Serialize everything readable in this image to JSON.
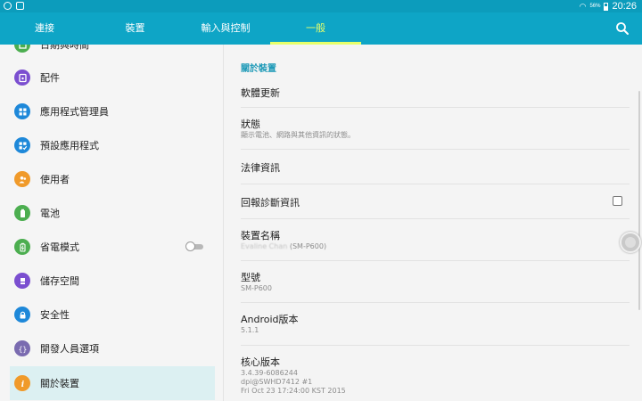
{
  "status_bar": {
    "battery_percent": "56%",
    "time": "20:26",
    "battery_level": 0.56,
    "icons": [
      "android-status-icon",
      "notification-icon",
      "wifi-icon",
      "battery-icon"
    ]
  },
  "tabs": [
    {
      "label": "連接",
      "active": false
    },
    {
      "label": "裝置",
      "active": false
    },
    {
      "label": "輸入與控制",
      "active": false
    },
    {
      "label": "一般",
      "active": true
    }
  ],
  "search_icon": "search-icon",
  "colors": {
    "tabbar": "#0ea5c6",
    "statusbar": "#0c9cbc",
    "active_tab": "#e7ff6a",
    "accent_text": "#1a98b6",
    "selected_item_bg": "#dcf0f2"
  },
  "left_menu": [
    {
      "label": "日期與時間",
      "icon": "calendar-icon",
      "color": "#4cae50",
      "active": false
    },
    {
      "label": "配件",
      "icon": "accessory-icon",
      "color": "#7b4fd0",
      "active": false
    },
    {
      "label": "應用程式管理員",
      "icon": "apps-grid-icon",
      "color": "#1e88d9",
      "active": false
    },
    {
      "label": "預設應用程式",
      "icon": "default-apps-icon",
      "color": "#1e88d9",
      "active": false
    },
    {
      "label": "使用者",
      "icon": "users-icon",
      "color": "#f09a2a",
      "active": false
    },
    {
      "label": "電池",
      "icon": "battery-icon",
      "color": "#4cae50",
      "active": false
    },
    {
      "label": "省電模式",
      "icon": "power-saving-icon",
      "color": "#4cae50",
      "active": false,
      "toggle": true
    },
    {
      "label": "儲存空間",
      "icon": "storage-icon",
      "color": "#7b4fd0",
      "active": false
    },
    {
      "label": "安全性",
      "icon": "lock-icon",
      "color": "#1e88d9",
      "active": false
    },
    {
      "label": "開發人員選項",
      "icon": "developer-icon",
      "color": "#7a6bb0",
      "active": false
    },
    {
      "label": "關於裝置",
      "icon": "info-icon",
      "color": "#f09a2a",
      "active": true
    }
  ],
  "right_panel": {
    "section_header": "關於裝置",
    "items": [
      {
        "title": "軟體更新"
      },
      {
        "title": "狀態",
        "sub": "顯示電池、網路與其他資訊的狀態。"
      },
      {
        "title": "法律資訊"
      },
      {
        "title": "回報診斷資訊",
        "checkbox": false
      },
      {
        "title": "裝置名稱",
        "sub_blurred": "Evaline Chan",
        "sub": " (SM-P600)"
      },
      {
        "title": "型號",
        "sub": "SM-P600"
      },
      {
        "title": "Android版本",
        "sub": "5.1.1"
      },
      {
        "title": "核心版本",
        "sub": "3.4.39-6086244",
        "sub2": "dpi@SWHD7412 #1",
        "sub3": "Fri Oct 23 17:24:00 KST 2015"
      }
    ]
  }
}
